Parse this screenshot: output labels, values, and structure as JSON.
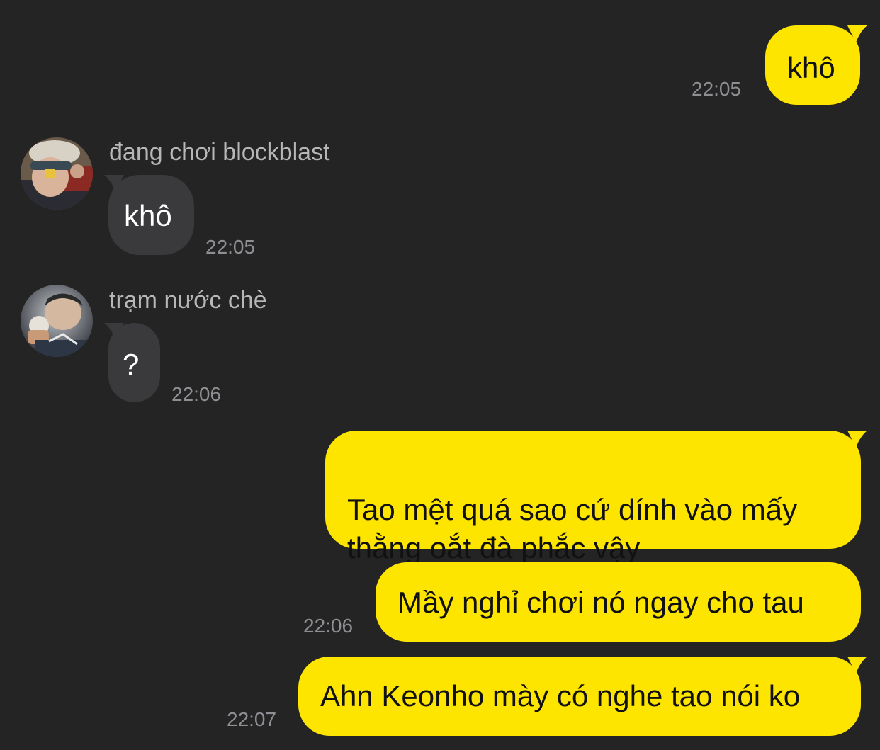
{
  "colors": {
    "background": "#242424",
    "outgoing_bubble": "#FEE500",
    "incoming_bubble": "#3a3a3c",
    "timestamp": "#8e8e93",
    "sender_name": "#b7b7b7"
  },
  "messages": [
    {
      "direction": "outgoing",
      "text": "khô",
      "time": "22:05"
    },
    {
      "direction": "incoming",
      "sender": "đang chơi blockblast",
      "avatar": "user-photo-avatar",
      "text": "khô",
      "time": "22:05"
    },
    {
      "direction": "incoming",
      "sender": "trạm nước chè",
      "avatar": "user-photo-avatar",
      "text": "?",
      "time": "22:06"
    },
    {
      "direction": "outgoing",
      "text": "Tao mệt quá sao cứ dính vào mấy\nthằng oắt đà phắc vậy"
    },
    {
      "direction": "outgoing",
      "text": "Mầy nghỉ chơi nó ngay cho tau",
      "time": "22:06"
    },
    {
      "direction": "outgoing",
      "text": "Ahn Keonho mày có nghe tao nói ko",
      "time": "22:07"
    }
  ]
}
